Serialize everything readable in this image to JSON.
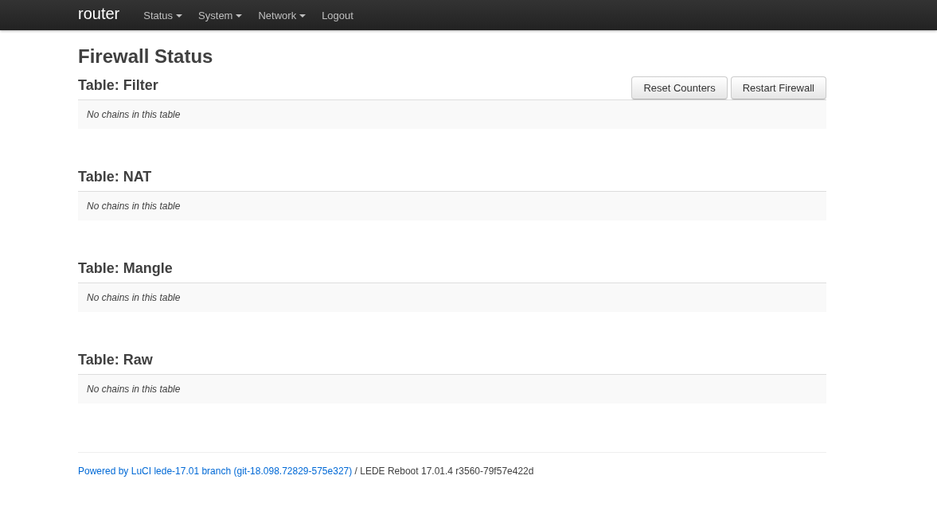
{
  "navbar": {
    "brand": "router",
    "menu": [
      {
        "label": "Status",
        "dropdown": true
      },
      {
        "label": "System",
        "dropdown": true
      },
      {
        "label": "Network",
        "dropdown": true
      },
      {
        "label": "Logout",
        "dropdown": false
      }
    ]
  },
  "page": {
    "title": "Firewall Status",
    "buttons": [
      "Reset Counters",
      "Restart Firewall"
    ]
  },
  "tables": [
    {
      "title": "Table: Filter",
      "empty_message": "No chains in this table"
    },
    {
      "title": "Table: NAT",
      "empty_message": "No chains in this table"
    },
    {
      "title": "Table: Mangle",
      "empty_message": "No chains in this table"
    },
    {
      "title": "Table: Raw",
      "empty_message": "No chains in this table"
    }
  ],
  "footer": {
    "link": "Powered by LuCI lede-17.01 branch (git-18.098.72829-575e327)",
    "text": " / LEDE Reboot 17.01.4 r3560-79f57e422d"
  }
}
